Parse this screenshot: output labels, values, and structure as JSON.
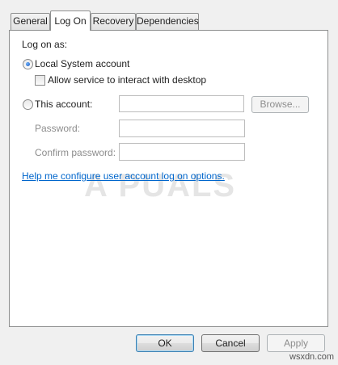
{
  "tabs": [
    {
      "label": "General",
      "active": false
    },
    {
      "label": "Log On",
      "active": true
    },
    {
      "label": "Recovery",
      "active": false
    },
    {
      "label": "Dependencies",
      "active": false
    }
  ],
  "logon": {
    "log_on_as_label": "Log on as:",
    "local_system_label": "Local System account",
    "local_system_selected": true,
    "interact_desktop_label": "Allow service to interact with desktop",
    "interact_desktop_checked": false,
    "this_account_label": "This account:",
    "this_account_value": "",
    "browse_label": "Browse...",
    "password_label": "Password:",
    "password_value": "",
    "confirm_password_label": "Confirm password:",
    "confirm_password_value": "",
    "help_link": "Help me configure user account log on options."
  },
  "buttons": {
    "ok": "OK",
    "cancel": "Cancel",
    "apply": "Apply"
  },
  "watermarks": {
    "appuals": "A  PUALS",
    "site": "wsxdn.com"
  },
  "colors": {
    "link": "#0066cc",
    "disabled_text": "#8d8d8d",
    "window_bg": "#f0f0f0"
  }
}
